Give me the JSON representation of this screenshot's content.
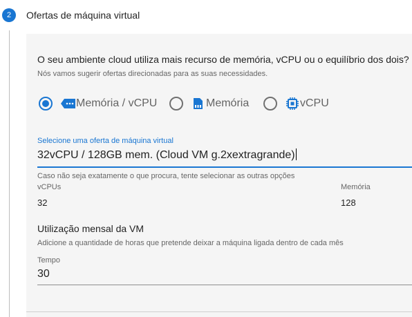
{
  "step": {
    "number": "2",
    "title": "Ofertas de máquina virtual"
  },
  "question": {
    "text": "O seu ambiente cloud utiliza mais recurso de memória, vCPU ou o equilíbrio dos dois?",
    "hint": "Nós vamos sugerir ofertas direcionadas para as suas necessidades."
  },
  "radio_options": [
    {
      "label": "Memória / vCPU",
      "icon": "balance-icon",
      "selected": true
    },
    {
      "label": "Memória",
      "icon": "memory-icon",
      "selected": false
    },
    {
      "label": "vCPU",
      "icon": "cpu-icon",
      "selected": false
    }
  ],
  "offer_field": {
    "label": "Selecione uma oferta de máquina virtual",
    "value": "32vCPU / 128GB mem. (Cloud VM g.2xextragrande)",
    "help": "Caso não seja exatamente o que procura, tente selecionar as outras opções"
  },
  "specs": {
    "vcpu_label": "vCPUs",
    "vcpu_value": "32",
    "memory_label": "Memória",
    "memory_value": "128"
  },
  "usage": {
    "title": "Utilização mensal da VM",
    "hint": "Adicione a quantidade de horas que pretende deixar a máquina ligada dentro de cada mês"
  },
  "time_field": {
    "label": "Tempo",
    "value": "30"
  },
  "colors": {
    "accent": "#1976d2",
    "panel_bg": "#f5f5f5"
  }
}
